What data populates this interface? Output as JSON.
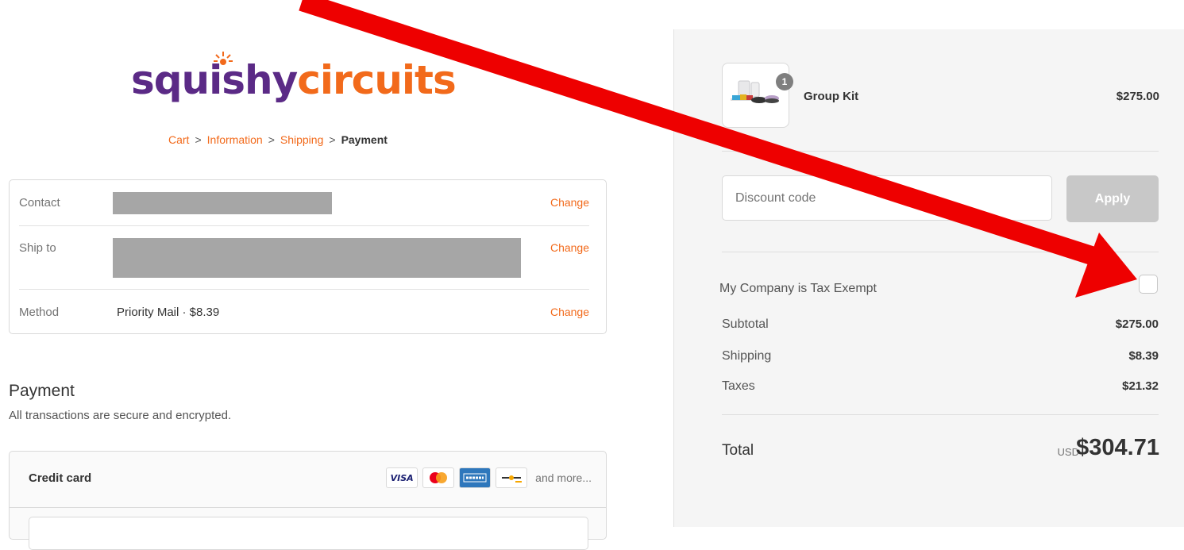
{
  "brand": {
    "word1": "squishy",
    "word2": "circuits"
  },
  "breadcrumb": {
    "items": [
      "Cart",
      "Information",
      "Shipping"
    ],
    "current": "Payment",
    "separator": ">"
  },
  "review": {
    "contact_label": "Contact",
    "ship_label": "Ship to",
    "method_label": "Method",
    "method_value": "Priority Mail · $8.39",
    "change_label": "Change"
  },
  "payment": {
    "heading": "Payment",
    "subtitle": "All transactions are secure and encrypted.",
    "credit_card_label": "Credit card",
    "card_icons": [
      "visa-icon",
      "mastercard-icon",
      "amex-icon",
      "generic-card-icon"
    ],
    "more_label": "and more..."
  },
  "order": {
    "item_name": "Group Kit",
    "item_price": "$275.00",
    "item_qty": "1",
    "discount_placeholder": "Discount code",
    "apply_label": "Apply",
    "tax_exempt_label": "My Company is Tax Exempt",
    "subtotal_label": "Subtotal",
    "subtotal_value": "$275.00",
    "shipping_label": "Shipping",
    "shipping_value": "$8.39",
    "taxes_label": "Taxes",
    "taxes_value": "$21.32",
    "total_label": "Total",
    "currency": "USD",
    "total_value": "$304.71"
  },
  "colors": {
    "brand_purple": "#5b2a86",
    "brand_orange": "#f26a1b",
    "annotation_red": "#ee0000"
  }
}
